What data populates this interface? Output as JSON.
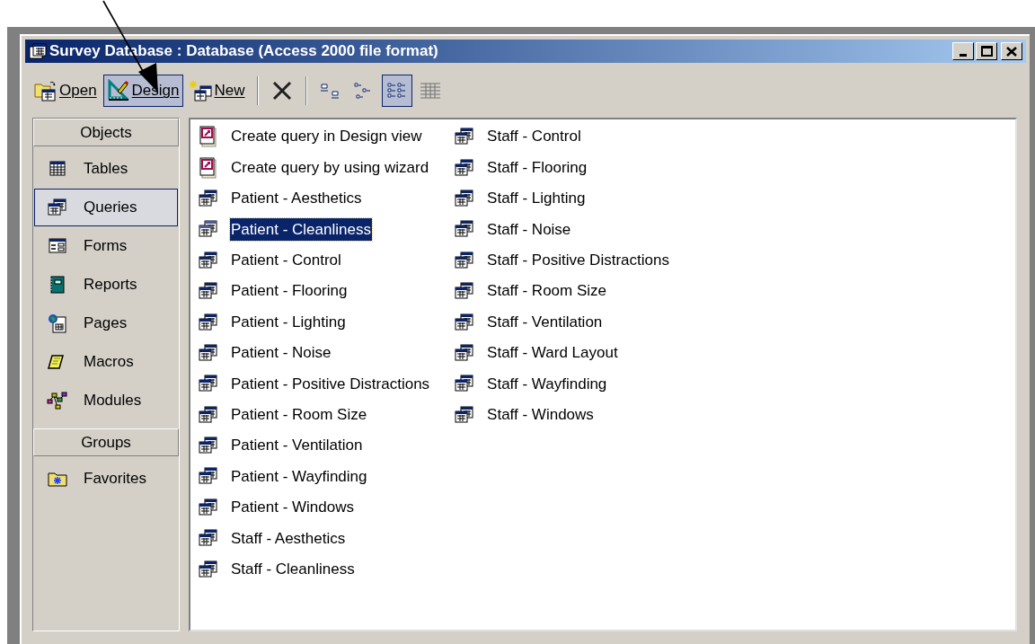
{
  "window": {
    "title": "Survey Database : Database (Access 2000 file format)"
  },
  "toolbar": [
    {
      "kind": "open",
      "label": "Open",
      "selected": false
    },
    {
      "kind": "design",
      "label": "Design",
      "selected": true
    },
    {
      "kind": "new",
      "label": "New",
      "selected": false
    },
    {
      "kind": "delete",
      "selected": false
    },
    {
      "kind": "large-icons",
      "selected": false
    },
    {
      "kind": "small-icons",
      "selected": false
    },
    {
      "kind": "list",
      "selected": true
    },
    {
      "kind": "details",
      "selected": false
    }
  ],
  "sidebar": {
    "sections": [
      {
        "header": "Objects",
        "items": [
          {
            "kind": "tables",
            "label": "Tables",
            "selected": false
          },
          {
            "kind": "queries",
            "label": "Queries",
            "selected": true
          },
          {
            "kind": "forms",
            "label": "Forms",
            "selected": false
          },
          {
            "kind": "reports",
            "label": "Reports",
            "selected": false
          },
          {
            "kind": "pages",
            "label": "Pages",
            "selected": false
          },
          {
            "kind": "macros",
            "label": "Macros",
            "selected": false
          },
          {
            "kind": "modules",
            "label": "Modules",
            "selected": false
          }
        ]
      },
      {
        "header": "Groups",
        "items": [
          {
            "kind": "favorites",
            "label": "Favorites",
            "selected": false
          }
        ]
      }
    ]
  },
  "list": {
    "items": [
      {
        "kind": "shortcut",
        "label": "Create query in Design view",
        "selected": false
      },
      {
        "kind": "shortcut",
        "label": "Create query by using wizard",
        "selected": false
      },
      {
        "kind": "query",
        "label": "Patient - Aesthetics",
        "selected": false
      },
      {
        "kind": "query",
        "label": "Patient - Cleanliness",
        "selected": true
      },
      {
        "kind": "query",
        "label": "Patient - Control",
        "selected": false
      },
      {
        "kind": "query",
        "label": "Patient - Flooring",
        "selected": false
      },
      {
        "kind": "query",
        "label": "Patient - Lighting",
        "selected": false
      },
      {
        "kind": "query",
        "label": "Patient - Noise",
        "selected": false
      },
      {
        "kind": "query",
        "label": "Patient - Positive Distractions",
        "selected": false
      },
      {
        "kind": "query",
        "label": "Patient - Room Size",
        "selected": false
      },
      {
        "kind": "query",
        "label": "Patient - Ventilation",
        "selected": false
      },
      {
        "kind": "query",
        "label": "Patient - Wayfinding",
        "selected": false
      },
      {
        "kind": "query",
        "label": "Patient - Windows",
        "selected": false
      },
      {
        "kind": "query",
        "label": "Staff - Aesthetics",
        "selected": false
      },
      {
        "kind": "query",
        "label": "Staff - Cleanliness",
        "selected": false
      },
      {
        "kind": "query",
        "label": "Staff - Control",
        "selected": false
      },
      {
        "kind": "query",
        "label": "Staff - Flooring",
        "selected": false
      },
      {
        "kind": "query",
        "label": "Staff - Lighting",
        "selected": false
      },
      {
        "kind": "query",
        "label": "Staff - Noise",
        "selected": false
      },
      {
        "kind": "query",
        "label": "Staff - Positive Distractions",
        "selected": false
      },
      {
        "kind": "query",
        "label": "Staff - Room Size",
        "selected": false
      },
      {
        "kind": "query",
        "label": "Staff - Ventilation",
        "selected": false
      },
      {
        "kind": "query",
        "label": "Staff - Ward Layout",
        "selected": false
      },
      {
        "kind": "query",
        "label": "Staff - Wayfinding",
        "selected": false
      },
      {
        "kind": "query",
        "label": "Staff - Windows",
        "selected": false
      }
    ]
  }
}
